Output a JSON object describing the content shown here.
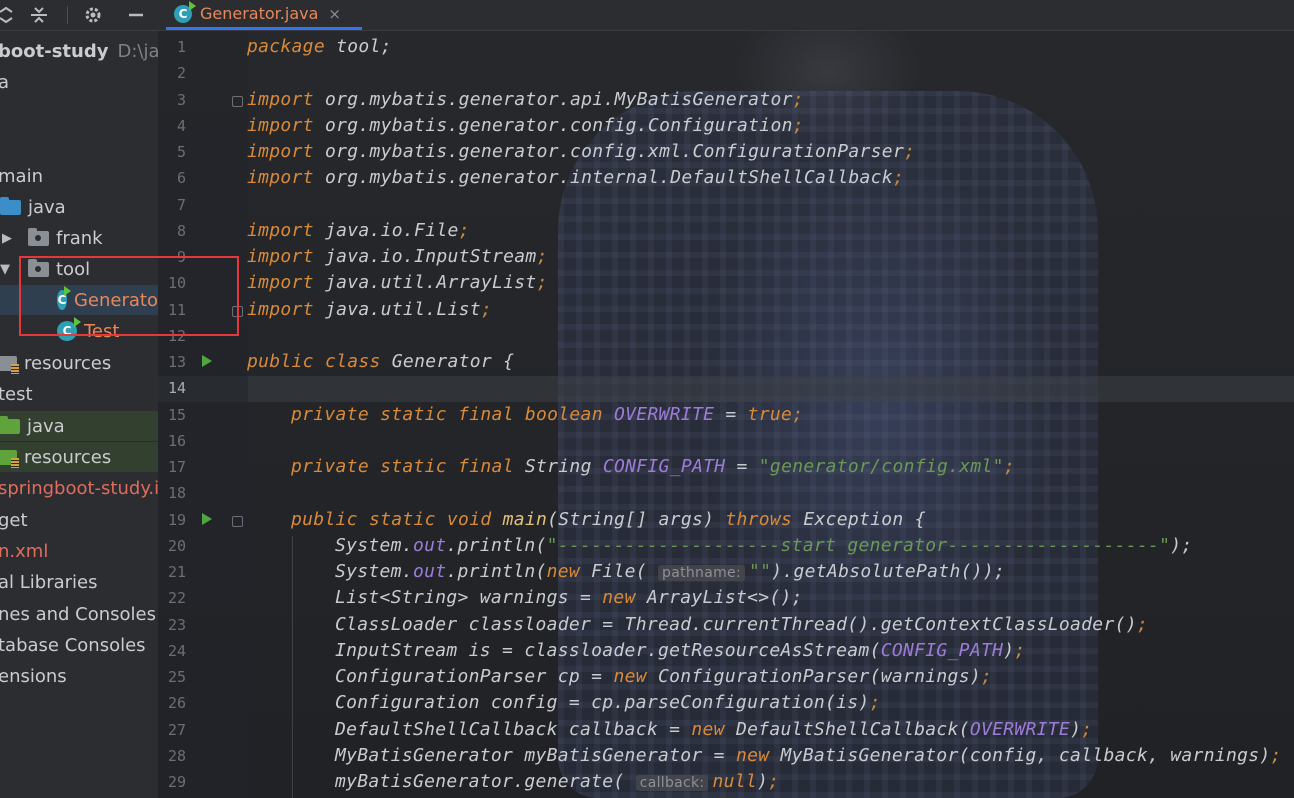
{
  "toolbar": {
    "icons": [
      "collapse-icon",
      "expand-icon",
      "gear-icon",
      "minimize-icon"
    ]
  },
  "project": {
    "items": [
      {
        "label": "boot-study",
        "path": "D:\\java"
      },
      {
        "label": "a"
      },
      {
        "label": "main"
      },
      {
        "label": "java"
      },
      {
        "label": "frank"
      },
      {
        "label": "tool"
      },
      {
        "label": "Generato"
      },
      {
        "label": "Test"
      },
      {
        "label": "resources"
      },
      {
        "label": "test"
      },
      {
        "label": "java"
      },
      {
        "label": "resources"
      },
      {
        "label": "springboot-study.i"
      },
      {
        "label": "get"
      },
      {
        "label": "n.xml"
      },
      {
        "label": "al Libraries"
      },
      {
        "label": "nes and Consoles"
      },
      {
        "label": "tabase Consoles"
      },
      {
        "label": "ensions"
      }
    ]
  },
  "tab": {
    "label": "Generator.java",
    "close": "×"
  },
  "editor": {
    "line_numbers": [
      "1",
      "2",
      "3",
      "4",
      "5",
      "6",
      "7",
      "8",
      "9",
      "10",
      "11",
      "12",
      "13",
      "14",
      "15",
      "16",
      "17",
      "18",
      "19",
      "20",
      "21",
      "22",
      "23",
      "24",
      "25",
      "26",
      "27",
      "28",
      "29"
    ],
    "lines": {
      "l1a": "package",
      "l1b": " tool;",
      "l3a": "import",
      "l3b": " org.mybatis.generator.api.MyBatisGenerator",
      "l4a": "import",
      "l4b": " org.mybatis.generator.config.Configuration",
      "l5a": "import",
      "l5b": " org.mybatis.generator.config.xml.ConfigurationParser",
      "l6a": "import",
      "l6b": " org.mybatis.generator.internal.DefaultShellCallback",
      "l8a": "import",
      "l8b": " java.io.File",
      "l9a": "import",
      "l9b": " java.io.InputStream",
      "l10a": "import",
      "l10b": " java.util.ArrayList",
      "l11a": "import",
      "l11b": " java.util.List",
      "semi": ";",
      "l13a": "public class",
      "l13b": " Generator {",
      "l15a": "private static final boolean",
      "l15b": "OVERWRITE",
      "l15c": " = ",
      "l15d": "true",
      "l17a": "private static final",
      "l17b": " String ",
      "l17c": "CONFIG_PATH",
      "l17d": " = ",
      "l17e": "\"generator/config.xml\"",
      "l19a": "public static void",
      "l19b": "main",
      "l19c": "(String[] args) ",
      "l19d": "throws",
      "l19e": " Exception {",
      "l20a": "System.",
      "l20b": "out",
      "l20c": ".println(",
      "l20d": "\"--------------------start generator-------------------\"",
      "l20e": ");",
      "l21a": "System.",
      "l21b": "out",
      "l21c": ".println(",
      "l21d": "new",
      "l21e": " File(",
      "l21hint": "pathname:",
      "l21f": "\"\"",
      "l21g": ").getAbsolutePath());",
      "l22a": "List<String> warnings = ",
      "l22b": "new",
      "l22c": " ArrayList<>();",
      "l23a": "ClassLoader classloader = Thread.currentThread().getContextClassLoader()",
      "l24a": "InputStream is = classloader.getResourceAsStream(",
      "l24b": "CONFIG_PATH",
      "l24c": ")",
      "l25a": "ConfigurationParser cp = ",
      "l25b": "new",
      "l25c": " ConfigurationParser(warnings)",
      "l26a": "Configuration config = cp.parseConfiguration(is)",
      "l27a": "DefaultShellCallback callback = ",
      "l27b": "new",
      "l27c": " DefaultShellCallback(",
      "l27d": "OVERWRITE",
      "l27e": ")",
      "l28a": "MyBatisGenerator myBatisGenerator = ",
      "l28b": "new",
      "l28c": " MyBatisGenerator(config, callback, warnings)",
      "l29a": "myBatisGenerator.generate(",
      "l29hint": "callback:",
      "l29b": "null",
      "l29c": ")"
    }
  },
  "colors": {
    "keyword": "#d88a3a",
    "string": "#6a9955",
    "field": "#9d7cd8",
    "method": "#e2c07a",
    "highlight_box": "#e5383b",
    "tab_text": "#e8875a"
  }
}
